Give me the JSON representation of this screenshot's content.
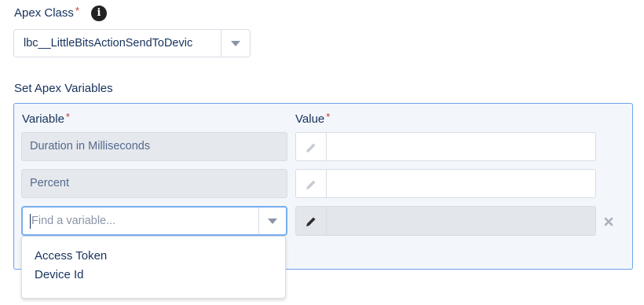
{
  "apex_class": {
    "label": "Apex Class",
    "required_mark": "*",
    "info_icon": "info-icon",
    "selected_value": "lbc__LittleBitsActionSendToDevic"
  },
  "variables_section": {
    "title": "Set Apex Variables",
    "variable_header": "Variable",
    "value_header": "Value",
    "required_mark": "*",
    "rows": [
      {
        "variable": "Duration in Milliseconds",
        "value": ""
      },
      {
        "variable": "Percent",
        "value": ""
      }
    ],
    "new_row": {
      "placeholder": "Find a variable...",
      "remove_icon": "close-icon"
    },
    "dropdown_options": [
      "Access Token",
      "Device Id"
    ]
  }
}
